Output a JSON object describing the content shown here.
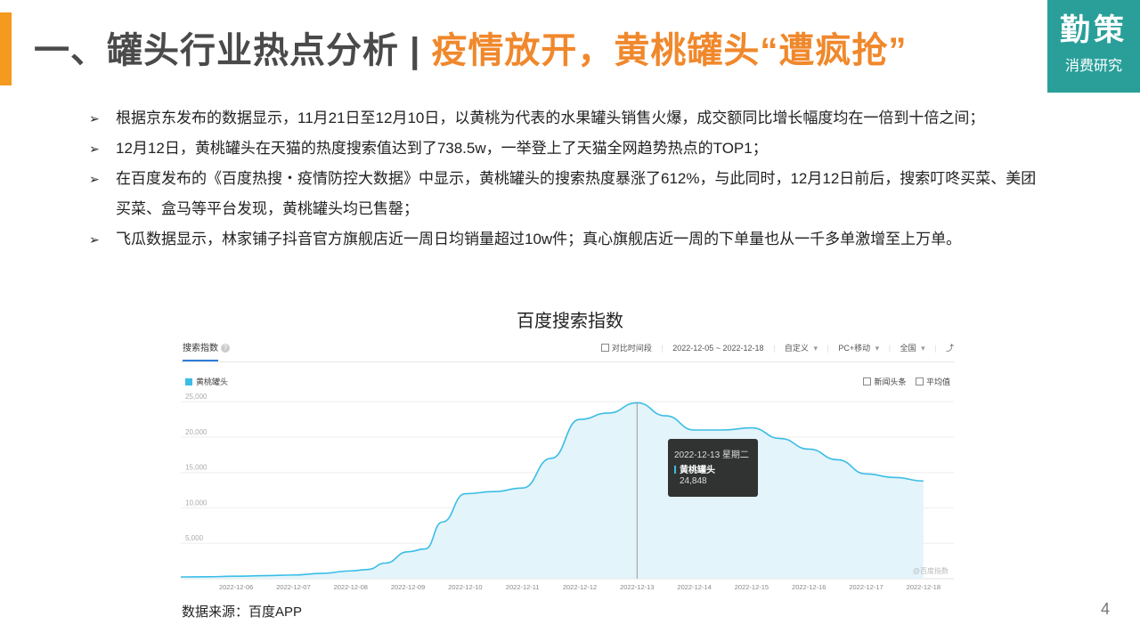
{
  "header": {
    "title_main": "一、罐头行业热点分析 | ",
    "title_highlight": "疫情放开，黄桃罐头“遭疯抢”",
    "logo_line1": "勤策",
    "logo_line2": "消费研究"
  },
  "bullets": [
    "根据京东发布的数据显示，11月21日至12月10日，以黄桃为代表的水果罐头销售火爆，成交额同比增长幅度均在一倍到十倍之间；",
    "12月12日，黄桃罐头在天猫的热度搜索值达到了738.5w，一举登上了天猫全网趋势热点的TOP1；",
    "在百度发布的《百度热搜・疫情防控大数据》中显示，黄桃罐头的搜索热度暴涨了612%，与此同时，12月12日前后，搜索叮咚买菜、美团买菜、盒马等平台发现，黄桃罐头均已售罄；",
    "飞瓜数据显示，林家铺子抖音官方旗舰店近一周日均销量超过10w件；真心旗舰店近一周的下单量也从一千多单激增至上万单。"
  ],
  "chart_caption": "百度搜索指数",
  "panel": {
    "tab_label": "搜索指数",
    "help_icon": "?",
    "compare_label": "对比时间段",
    "date_range": "2022-12-05 ~ 2022-12-18",
    "custom_label": "自定义",
    "device_label": "PC+移动",
    "region_label": "全国",
    "dropdown_glyph": "▾",
    "export_icon": "⤴",
    "legend_label": "黄桃罐头",
    "news_label": "新闻头条",
    "avg_label": "平均值",
    "watermark": "@百度指数"
  },
  "tooltip": {
    "date": "2022-12-13 星期二",
    "series": "黄桃罐头",
    "value": "24,848"
  },
  "chart_data": {
    "type": "area",
    "title": "百度搜索指数",
    "x": [
      "2022-12-06",
      "2022-12-07",
      "2022-12-08",
      "2022-12-09",
      "2022-12-10",
      "2022-12-11",
      "2022-12-12",
      "2022-12-13",
      "2022-12-14",
      "2022-12-15",
      "2022-12-16",
      "2022-12-17",
      "2022-12-18"
    ],
    "series": [
      {
        "name": "黄桃罐头",
        "x": [
          -1,
          -0.5,
          0,
          0.5,
          1,
          1.5,
          2,
          2.3,
          2.6,
          3,
          3.3,
          3.6,
          4,
          4.5,
          5,
          5.5,
          6,
          6.5,
          7,
          7.5,
          8,
          8.5,
          9,
          9.5,
          10,
          10.5,
          11,
          11.5,
          12
        ],
        "values": [
          250,
          280,
          350,
          430,
          520,
          750,
          1100,
          1300,
          2200,
          3800,
          4200,
          8000,
          12000,
          12300,
          12800,
          17000,
          22500,
          23400,
          24848,
          23000,
          21000,
          21000,
          21300,
          19800,
          18300,
          16800,
          14800,
          14300,
          13800
        ]
      }
    ],
    "y_ticks": [
      "5,000",
      "10,000",
      "15,000",
      "20,000",
      "25,000"
    ],
    "ylim": [
      0,
      25000
    ],
    "grid": true,
    "line_color": "#3bbde6",
    "fill_color": "#e3f4fa"
  },
  "source_text": "数据来源：百度APP",
  "page_number": "4",
  "colors": {
    "accent_orange": "#f39a1f",
    "highlight_orange": "#f0882c",
    "logo_teal": "#2a9f9a"
  }
}
